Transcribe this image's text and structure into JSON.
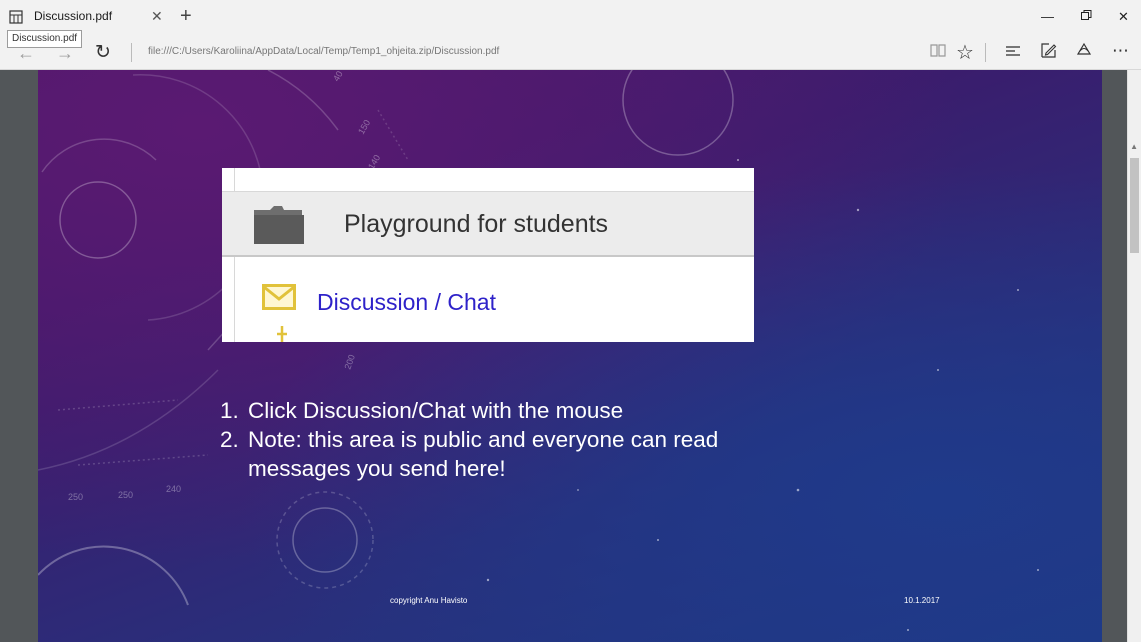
{
  "browser": {
    "tab": {
      "title": "Discussion.pdf",
      "tooltip": "Discussion.pdf",
      "close_icon": "close-icon",
      "pdf_icon": "pdf-document-icon"
    },
    "new_tab_symbol": "+",
    "address": "file:///C:/Users/Karoliina/AppData/Local/Temp/Temp1_ohjeita.zip/Discussion.pdf",
    "nav_icons": [
      "back-arrow-icon",
      "forward-arrow-icon",
      "refresh-icon"
    ],
    "tool_icons": [
      "reading-view-icon",
      "favorite-star-icon",
      "hub-icon",
      "web-note-icon",
      "share-icon",
      "more-icon"
    ],
    "window_controls": [
      "minimize-icon",
      "restore-icon",
      "close-window-icon"
    ]
  },
  "slide": {
    "snapshot": {
      "heading": "Playground for students",
      "link": "Discussion / Chat"
    },
    "instructions": [
      {
        "num": "1.",
        "text": "Click Discussion/Chat with the mouse"
      },
      {
        "num": "2.",
        "text": "Note: this area is public and everyone can read messages you send here!"
      }
    ],
    "footer_left": "copyright Anu Havisto",
    "footer_right": "10.1.2017",
    "dial_numbers": [
      "250",
      "250",
      "240",
      "150",
      "140",
      "40",
      "200"
    ]
  },
  "colors": {
    "chrome_bg": "#f2f2f2",
    "viewer_bg": "#525659",
    "slide_purple": "#4d1766",
    "slide_blue": "#1d3a86",
    "link_blue": "#2e22c9",
    "mail_yellow": "#e1c23a"
  }
}
